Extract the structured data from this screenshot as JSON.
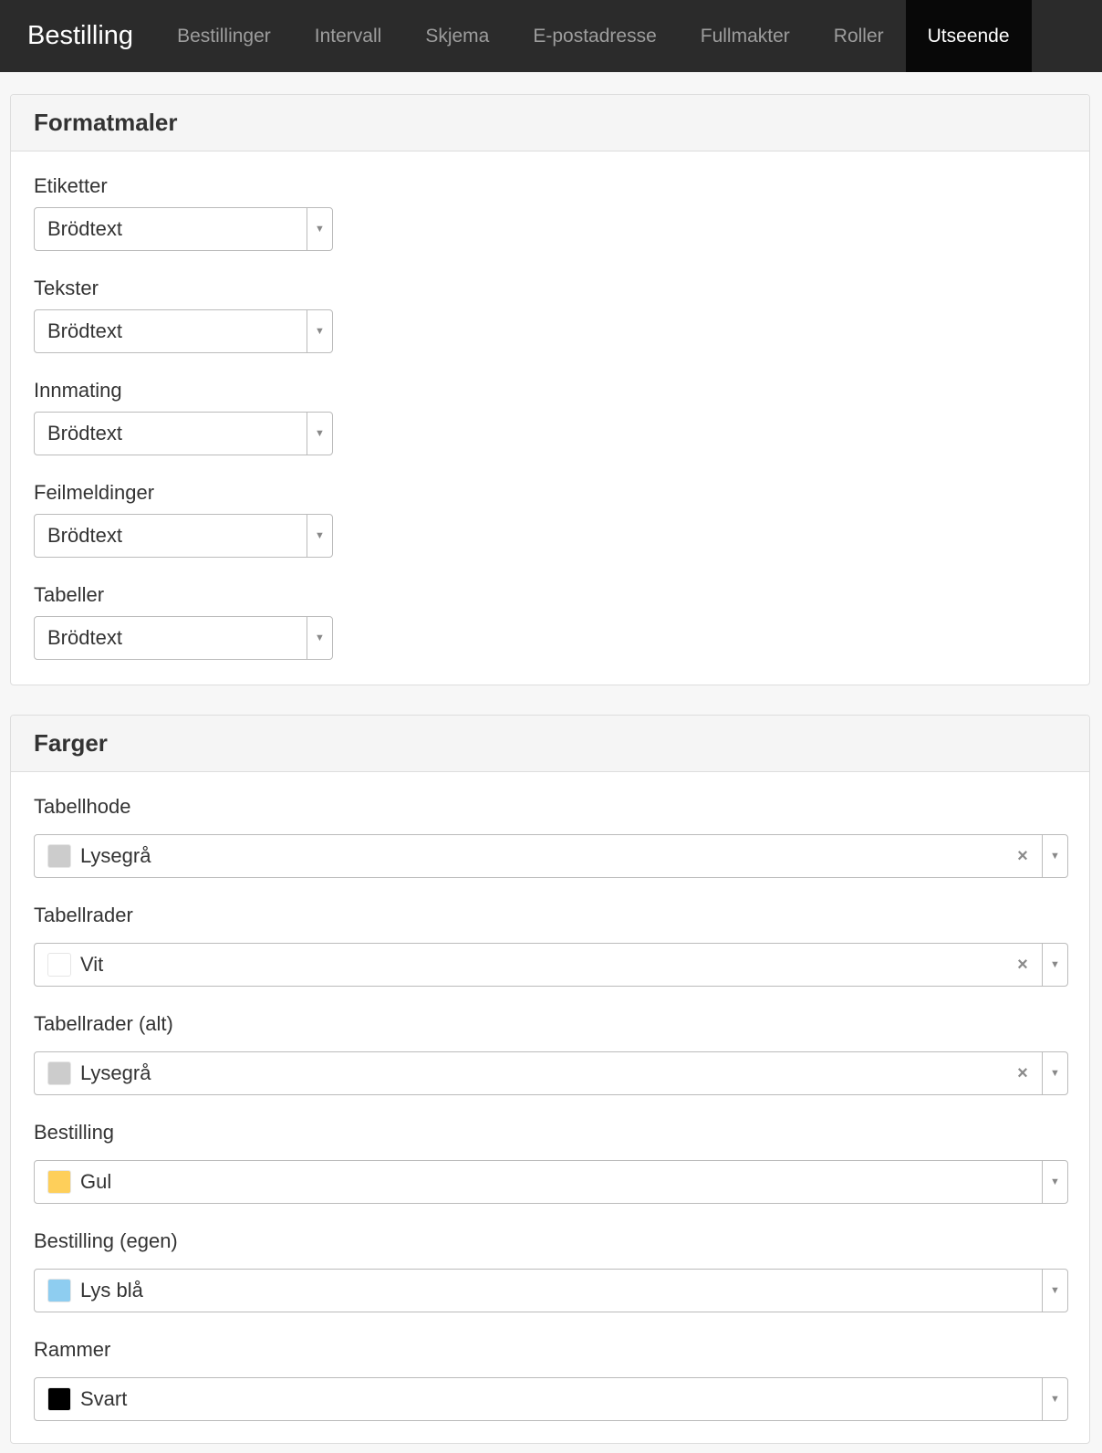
{
  "navbar": {
    "brand": "Bestilling",
    "items": [
      {
        "label": "Bestillinger",
        "active": false
      },
      {
        "label": "Intervall",
        "active": false
      },
      {
        "label": "Skjema",
        "active": false
      },
      {
        "label": "E-postadresse",
        "active": false
      },
      {
        "label": "Fullmakter",
        "active": false
      },
      {
        "label": "Roller",
        "active": false
      },
      {
        "label": "Utseende",
        "active": true
      }
    ]
  },
  "formatmaler": {
    "title": "Formatmaler",
    "fields": [
      {
        "label": "Etiketter",
        "value": "Brödtext"
      },
      {
        "label": "Tekster",
        "value": "Brödtext"
      },
      {
        "label": "Innmating",
        "value": "Brödtext"
      },
      {
        "label": "Feilmeldinger",
        "value": "Brödtext"
      },
      {
        "label": "Tabeller",
        "value": "Brödtext"
      }
    ]
  },
  "farger": {
    "title": "Farger",
    "fields": [
      {
        "label": "Tabellhode",
        "value": "Lysegrå",
        "swatch": "#cccccc",
        "clearable": true
      },
      {
        "label": "Tabellrader",
        "value": "Vit",
        "swatch": "#ffffff",
        "clearable": true
      },
      {
        "label": "Tabellrader (alt)",
        "value": "Lysegrå",
        "swatch": "#cccccc",
        "clearable": true
      },
      {
        "label": "Bestilling",
        "value": "Gul",
        "swatch": "#fecf5a",
        "clearable": false
      },
      {
        "label": "Bestilling (egen)",
        "value": "Lys blå",
        "swatch": "#8ecdf0",
        "clearable": false
      },
      {
        "label": "Rammer",
        "value": "Svart",
        "swatch": "#000000",
        "clearable": false
      }
    ]
  },
  "icons": {
    "dropdown_arrow": "▼",
    "clear": "×"
  }
}
